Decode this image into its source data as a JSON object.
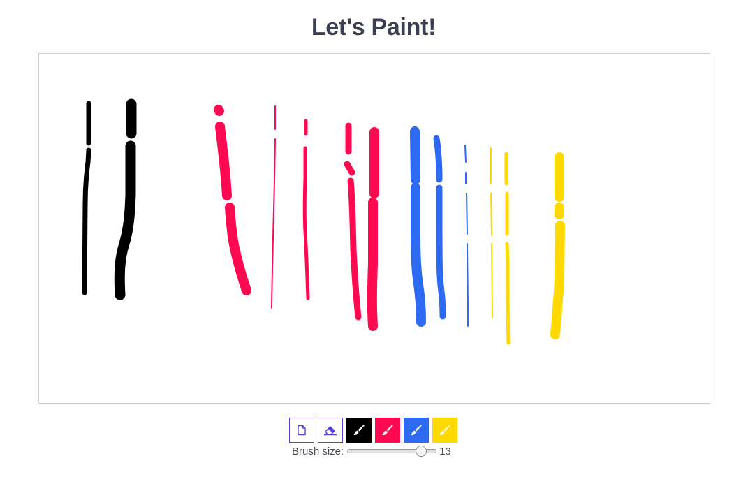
{
  "title": "Let's Paint!",
  "toolbar": {
    "tools": [
      {
        "name": "new-page",
        "icon": "file-icon"
      },
      {
        "name": "eraser",
        "icon": "eraser-icon"
      },
      {
        "name": "brush-black",
        "icon": "paintbrush-icon",
        "color": "#000000"
      },
      {
        "name": "brush-red",
        "icon": "paintbrush-icon",
        "color": "#ff0a50"
      },
      {
        "name": "brush-blue",
        "icon": "paintbrush-icon",
        "color": "#2d6af2"
      },
      {
        "name": "brush-yellow",
        "icon": "paintbrush-icon",
        "color": "#ffd900"
      }
    ],
    "accent_color": "#5b3fd6"
  },
  "brush_size": {
    "label": "Brush size:",
    "value": "13",
    "min": 1,
    "max": 15
  }
}
